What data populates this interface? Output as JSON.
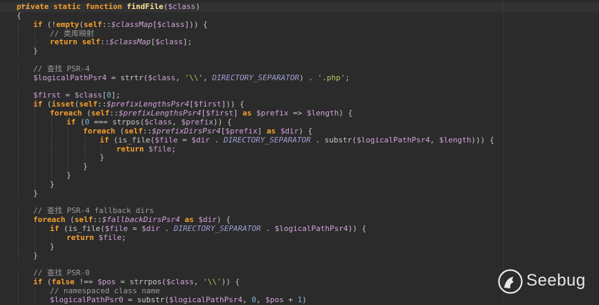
{
  "lines": [
    {
      "indent": 0,
      "tokens": [
        [
          "cm",
          "  */"
        ]
      ]
    },
    {
      "indent": 0,
      "tokens": [
        [
          "kw",
          "private static function "
        ],
        [
          "fn",
          "findFile"
        ],
        [
          "op",
          "("
        ],
        [
          "var",
          "$class"
        ],
        [
          "op",
          ")"
        ]
      ]
    },
    {
      "indent": 0,
      "tokens": [
        [
          "op",
          "{"
        ]
      ]
    },
    {
      "indent": 1,
      "tokens": [
        [
          "kw",
          "if "
        ],
        [
          "op",
          "(!"
        ],
        [
          "kw",
          "empty"
        ],
        [
          "op",
          "("
        ],
        [
          "kw",
          "self"
        ],
        [
          "op",
          "::"
        ],
        [
          "ivar",
          "$classMap"
        ],
        [
          "op",
          "["
        ],
        [
          "var",
          "$class"
        ],
        [
          "op",
          "])) {"
        ]
      ]
    },
    {
      "indent": 2,
      "tokens": [
        [
          "cm",
          "// 类库映射"
        ]
      ]
    },
    {
      "indent": 2,
      "tokens": [
        [
          "kw",
          "return "
        ],
        [
          "kw",
          "self"
        ],
        [
          "op",
          "::"
        ],
        [
          "ivar",
          "$classMap"
        ],
        [
          "op",
          "["
        ],
        [
          "var",
          "$class"
        ],
        [
          "op",
          "];"
        ]
      ]
    },
    {
      "indent": 1,
      "tokens": [
        [
          "op",
          "}"
        ]
      ]
    },
    {
      "indent": 0,
      "tokens": []
    },
    {
      "indent": 1,
      "tokens": [
        [
          "cm",
          "// 查找 PSR-4"
        ]
      ]
    },
    {
      "indent": 1,
      "tokens": [
        [
          "var",
          "$logicalPathPsr4"
        ],
        [
          "op",
          " = strtr("
        ],
        [
          "var",
          "$class"
        ],
        [
          "op",
          ", "
        ],
        [
          "str",
          "'\\\\'"
        ],
        [
          "op",
          ", "
        ],
        [
          "cst",
          "DIRECTORY_SEPARATOR"
        ],
        [
          "op",
          ") . "
        ],
        [
          "str",
          "'.php'"
        ],
        [
          "op",
          ";"
        ]
      ]
    },
    {
      "indent": 0,
      "tokens": []
    },
    {
      "indent": 1,
      "tokens": [
        [
          "var",
          "$first"
        ],
        [
          "op",
          " = "
        ],
        [
          "var",
          "$class"
        ],
        [
          "op",
          "["
        ],
        [
          "num",
          "0"
        ],
        [
          "op",
          "];"
        ]
      ]
    },
    {
      "indent": 1,
      "tokens": [
        [
          "kw",
          "if "
        ],
        [
          "op",
          "("
        ],
        [
          "kw",
          "isset"
        ],
        [
          "op",
          "("
        ],
        [
          "kw",
          "self"
        ],
        [
          "op",
          "::"
        ],
        [
          "ivar",
          "$prefixLengthsPsr4"
        ],
        [
          "op",
          "["
        ],
        [
          "var",
          "$first"
        ],
        [
          "op",
          "])) {"
        ]
      ]
    },
    {
      "indent": 2,
      "tokens": [
        [
          "kw",
          "foreach "
        ],
        [
          "op",
          "("
        ],
        [
          "kw",
          "self"
        ],
        [
          "op",
          "::"
        ],
        [
          "ivar",
          "$prefixLengthsPsr4"
        ],
        [
          "op",
          "["
        ],
        [
          "var",
          "$first"
        ],
        [
          "op",
          "] "
        ],
        [
          "kw",
          "as "
        ],
        [
          "var",
          "$prefix"
        ],
        [
          "op",
          " => "
        ],
        [
          "var",
          "$length"
        ],
        [
          "op",
          ") {"
        ]
      ]
    },
    {
      "indent": 3,
      "tokens": [
        [
          "kw",
          "if "
        ],
        [
          "op",
          "("
        ],
        [
          "num",
          "0"
        ],
        [
          "op",
          " === strpos("
        ],
        [
          "var",
          "$class"
        ],
        [
          "op",
          ", "
        ],
        [
          "var",
          "$prefix"
        ],
        [
          "op",
          ")) {"
        ]
      ]
    },
    {
      "indent": 4,
      "tokens": [
        [
          "kw",
          "foreach "
        ],
        [
          "op",
          "("
        ],
        [
          "kw",
          "self"
        ],
        [
          "op",
          "::"
        ],
        [
          "ivar",
          "$prefixDirsPsr4"
        ],
        [
          "op",
          "["
        ],
        [
          "var",
          "$prefix"
        ],
        [
          "op",
          "] "
        ],
        [
          "kw",
          "as "
        ],
        [
          "var",
          "$dir"
        ],
        [
          "op",
          ") {"
        ]
      ]
    },
    {
      "indent": 5,
      "tokens": [
        [
          "kw",
          "if "
        ],
        [
          "op",
          "(is_file("
        ],
        [
          "var",
          "$file"
        ],
        [
          "op",
          " = "
        ],
        [
          "var",
          "$dir"
        ],
        [
          "op",
          " . "
        ],
        [
          "cst",
          "DIRECTORY_SEPARATOR"
        ],
        [
          "op",
          " . substr("
        ],
        [
          "var",
          "$logicalPathPsr4"
        ],
        [
          "op",
          ", "
        ],
        [
          "var",
          "$length"
        ],
        [
          "op",
          "))) {"
        ]
      ]
    },
    {
      "indent": 6,
      "tokens": [
        [
          "kw",
          "return "
        ],
        [
          "var",
          "$file"
        ],
        [
          "op",
          ";"
        ]
      ]
    },
    {
      "indent": 5,
      "tokens": [
        [
          "op",
          "}"
        ]
      ]
    },
    {
      "indent": 4,
      "tokens": [
        [
          "op",
          "}"
        ]
      ]
    },
    {
      "indent": 3,
      "tokens": [
        [
          "op",
          "}"
        ]
      ]
    },
    {
      "indent": 2,
      "tokens": [
        [
          "op",
          "}"
        ]
      ]
    },
    {
      "indent": 1,
      "tokens": [
        [
          "op",
          "}"
        ]
      ]
    },
    {
      "indent": 0,
      "tokens": []
    },
    {
      "indent": 1,
      "tokens": [
        [
          "cm",
          "// 查找 PSR-4 fallback dirs"
        ]
      ]
    },
    {
      "indent": 1,
      "tokens": [
        [
          "kw",
          "foreach "
        ],
        [
          "op",
          "("
        ],
        [
          "kw",
          "self"
        ],
        [
          "op",
          "::"
        ],
        [
          "ivar",
          "$fallbackDirsPsr4"
        ],
        [
          "op",
          " "
        ],
        [
          "kw",
          "as "
        ],
        [
          "var",
          "$dir"
        ],
        [
          "op",
          ") {"
        ]
      ]
    },
    {
      "indent": 2,
      "tokens": [
        [
          "kw",
          "if "
        ],
        [
          "op",
          "(is_file("
        ],
        [
          "var",
          "$file"
        ],
        [
          "op",
          " = "
        ],
        [
          "var",
          "$dir"
        ],
        [
          "op",
          " . "
        ],
        [
          "cst",
          "DIRECTORY_SEPARATOR"
        ],
        [
          "op",
          " . "
        ],
        [
          "var",
          "$logicalPathPsr4"
        ],
        [
          "op",
          ")) {"
        ]
      ]
    },
    {
      "indent": 3,
      "tokens": [
        [
          "kw",
          "return "
        ],
        [
          "var",
          "$file"
        ],
        [
          "op",
          ";"
        ]
      ]
    },
    {
      "indent": 2,
      "tokens": [
        [
          "op",
          "}"
        ]
      ]
    },
    {
      "indent": 1,
      "tokens": [
        [
          "op",
          "}"
        ]
      ]
    },
    {
      "indent": 0,
      "tokens": []
    },
    {
      "indent": 1,
      "tokens": [
        [
          "cm",
          "// 查找 PSR-0"
        ]
      ]
    },
    {
      "indent": 1,
      "tokens": [
        [
          "kw",
          "if "
        ],
        [
          "op",
          "("
        ],
        [
          "kw",
          "false"
        ],
        [
          "op",
          " !== "
        ],
        [
          "var",
          "$pos"
        ],
        [
          "op",
          " = strrpos("
        ],
        [
          "var",
          "$class"
        ],
        [
          "op",
          ", "
        ],
        [
          "str",
          "'\\\\'"
        ],
        [
          "op",
          ")) {"
        ]
      ]
    },
    {
      "indent": 2,
      "tokens": [
        [
          "cm",
          "// namespaced class name"
        ]
      ]
    },
    {
      "indent": 2,
      "tokens": [
        [
          "var",
          "$logicalPathPsr0"
        ],
        [
          "op",
          " = substr("
        ],
        [
          "var",
          "$logicalPathPsr4"
        ],
        [
          "op",
          ", "
        ],
        [
          "num",
          "0"
        ],
        [
          "op",
          ", "
        ],
        [
          "var",
          "$pos"
        ],
        [
          "op",
          " + "
        ],
        [
          "num",
          "1"
        ],
        [
          "op",
          ")"
        ]
      ]
    }
  ],
  "watermark": {
    "brand": "Seebug",
    "icon": "seebug-logo-icon"
  },
  "colors": {
    "background": "#2b2b2b",
    "keyword": "#f6a02d",
    "function": "#fbe596",
    "variable": "#d0a3d8",
    "string": "#b5c85a",
    "constant": "#9f9fd4",
    "comment": "#9a9a9a"
  }
}
